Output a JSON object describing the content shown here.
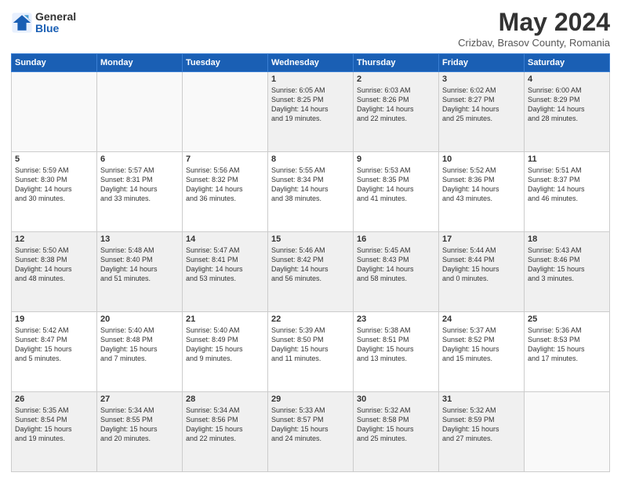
{
  "logo": {
    "general": "General",
    "blue": "Blue"
  },
  "title": "May 2024",
  "subtitle": "Crizbav, Brasov County, Romania",
  "days": [
    "Sunday",
    "Monday",
    "Tuesday",
    "Wednesday",
    "Thursday",
    "Friday",
    "Saturday"
  ],
  "weeks": [
    [
      {
        "num": "",
        "info": ""
      },
      {
        "num": "",
        "info": ""
      },
      {
        "num": "",
        "info": ""
      },
      {
        "num": "1",
        "info": "Sunrise: 6:05 AM\nSunset: 8:25 PM\nDaylight: 14 hours\nand 19 minutes."
      },
      {
        "num": "2",
        "info": "Sunrise: 6:03 AM\nSunset: 8:26 PM\nDaylight: 14 hours\nand 22 minutes."
      },
      {
        "num": "3",
        "info": "Sunrise: 6:02 AM\nSunset: 8:27 PM\nDaylight: 14 hours\nand 25 minutes."
      },
      {
        "num": "4",
        "info": "Sunrise: 6:00 AM\nSunset: 8:29 PM\nDaylight: 14 hours\nand 28 minutes."
      }
    ],
    [
      {
        "num": "5",
        "info": "Sunrise: 5:59 AM\nSunset: 8:30 PM\nDaylight: 14 hours\nand 30 minutes."
      },
      {
        "num": "6",
        "info": "Sunrise: 5:57 AM\nSunset: 8:31 PM\nDaylight: 14 hours\nand 33 minutes."
      },
      {
        "num": "7",
        "info": "Sunrise: 5:56 AM\nSunset: 8:32 PM\nDaylight: 14 hours\nand 36 minutes."
      },
      {
        "num": "8",
        "info": "Sunrise: 5:55 AM\nSunset: 8:34 PM\nDaylight: 14 hours\nand 38 minutes."
      },
      {
        "num": "9",
        "info": "Sunrise: 5:53 AM\nSunset: 8:35 PM\nDaylight: 14 hours\nand 41 minutes."
      },
      {
        "num": "10",
        "info": "Sunrise: 5:52 AM\nSunset: 8:36 PM\nDaylight: 14 hours\nand 43 minutes."
      },
      {
        "num": "11",
        "info": "Sunrise: 5:51 AM\nSunset: 8:37 PM\nDaylight: 14 hours\nand 46 minutes."
      }
    ],
    [
      {
        "num": "12",
        "info": "Sunrise: 5:50 AM\nSunset: 8:38 PM\nDaylight: 14 hours\nand 48 minutes."
      },
      {
        "num": "13",
        "info": "Sunrise: 5:48 AM\nSunset: 8:40 PM\nDaylight: 14 hours\nand 51 minutes."
      },
      {
        "num": "14",
        "info": "Sunrise: 5:47 AM\nSunset: 8:41 PM\nDaylight: 14 hours\nand 53 minutes."
      },
      {
        "num": "15",
        "info": "Sunrise: 5:46 AM\nSunset: 8:42 PM\nDaylight: 14 hours\nand 56 minutes."
      },
      {
        "num": "16",
        "info": "Sunrise: 5:45 AM\nSunset: 8:43 PM\nDaylight: 14 hours\nand 58 minutes."
      },
      {
        "num": "17",
        "info": "Sunrise: 5:44 AM\nSunset: 8:44 PM\nDaylight: 15 hours\nand 0 minutes."
      },
      {
        "num": "18",
        "info": "Sunrise: 5:43 AM\nSunset: 8:46 PM\nDaylight: 15 hours\nand 3 minutes."
      }
    ],
    [
      {
        "num": "19",
        "info": "Sunrise: 5:42 AM\nSunset: 8:47 PM\nDaylight: 15 hours\nand 5 minutes."
      },
      {
        "num": "20",
        "info": "Sunrise: 5:40 AM\nSunset: 8:48 PM\nDaylight: 15 hours\nand 7 minutes."
      },
      {
        "num": "21",
        "info": "Sunrise: 5:40 AM\nSunset: 8:49 PM\nDaylight: 15 hours\nand 9 minutes."
      },
      {
        "num": "22",
        "info": "Sunrise: 5:39 AM\nSunset: 8:50 PM\nDaylight: 15 hours\nand 11 minutes."
      },
      {
        "num": "23",
        "info": "Sunrise: 5:38 AM\nSunset: 8:51 PM\nDaylight: 15 hours\nand 13 minutes."
      },
      {
        "num": "24",
        "info": "Sunrise: 5:37 AM\nSunset: 8:52 PM\nDaylight: 15 hours\nand 15 minutes."
      },
      {
        "num": "25",
        "info": "Sunrise: 5:36 AM\nSunset: 8:53 PM\nDaylight: 15 hours\nand 17 minutes."
      }
    ],
    [
      {
        "num": "26",
        "info": "Sunrise: 5:35 AM\nSunset: 8:54 PM\nDaylight: 15 hours\nand 19 minutes."
      },
      {
        "num": "27",
        "info": "Sunrise: 5:34 AM\nSunset: 8:55 PM\nDaylight: 15 hours\nand 20 minutes."
      },
      {
        "num": "28",
        "info": "Sunrise: 5:34 AM\nSunset: 8:56 PM\nDaylight: 15 hours\nand 22 minutes."
      },
      {
        "num": "29",
        "info": "Sunrise: 5:33 AM\nSunset: 8:57 PM\nDaylight: 15 hours\nand 24 minutes."
      },
      {
        "num": "30",
        "info": "Sunrise: 5:32 AM\nSunset: 8:58 PM\nDaylight: 15 hours\nand 25 minutes."
      },
      {
        "num": "31",
        "info": "Sunrise: 5:32 AM\nSunset: 8:59 PM\nDaylight: 15 hours\nand 27 minutes."
      },
      {
        "num": "",
        "info": ""
      }
    ]
  ]
}
